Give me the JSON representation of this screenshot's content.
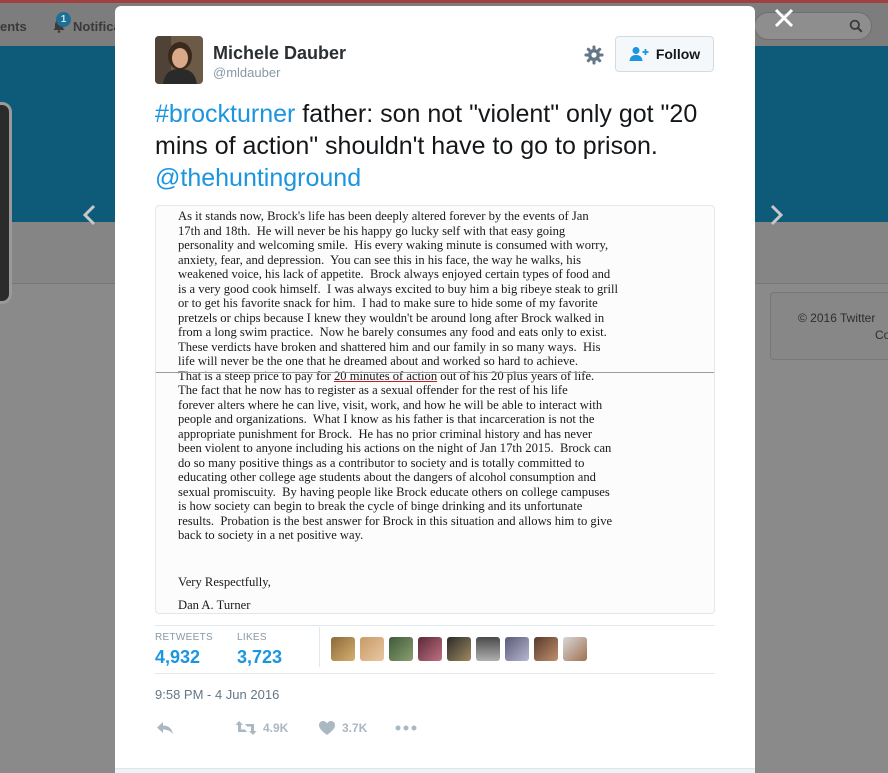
{
  "background": {
    "nav_left_fragment": "ents",
    "notifications_label": "Notifica",
    "notifications_count": "1",
    "copyright_line1": "© 2016 Twitter",
    "copyright_line2": "Co"
  },
  "tweet": {
    "author_name": "Michele Dauber",
    "author_handle": "@mldauber",
    "follow_label": "Follow",
    "text_hashtag": "#brockturner",
    "text_body": " father: son not \"violent\" only got \"20 mins of action\" shouldn't have to go to prison. ",
    "text_mention": "@thehuntinground",
    "retweets_label": "RETWEETS",
    "retweets_count": "4,932",
    "likes_label": "LIKES",
    "likes_count": "3,723",
    "timestamp": "9:58 PM - 4 Jun 2016",
    "retweet_action_count": "4.9K",
    "like_action_count": "3.7K"
  },
  "letter": {
    "lines_top": [
      "As it stands now, Brock's life has been deeply altered forever by the events of Jan",
      "17th and 18th.  He will never be his happy go lucky self with that easy going",
      "personality and welcoming smile.  His every waking minute is consumed with worry,",
      "anxiety, fear, and depression.  You can see this in his face, the way he walks, his",
      "weakened voice, his lack of appetite.  Brock always enjoyed certain types of food and",
      "is a very good cook himself.  I was always excited to buy him a big ribeye steak to grill",
      "or to get his favorite snack for him.  I had to make sure to hide some of my favorite",
      "pretzels or chips because I knew they wouldn't be around long after Brock walked in",
      "from a long swim practice.  Now he barely consumes any food and eats only to exist.",
      "These verdicts have broken and shattered him and our family in so many ways.  His",
      "life will never be the one that he dreamed about and worked so hard to achieve."
    ],
    "line_highlight_pre": "That is a steep price to pay for ",
    "line_highlight": "20 minutes of action",
    "line_highlight_post": " out of his 20 plus years of life.",
    "lines_bottom": [
      "The fact that he now has to register as a sexual offender for the rest of his life",
      "forever alters where he can live, visit, work, and how he will be able to interact with",
      "people and organizations.  What I know as his father is that incarceration is not the",
      "appropriate punishment for Brock.  He has no prior criminal history and has never",
      "been violent to anyone including his actions on the night of Jan 17th 2015.  Brock can",
      "do so many positive things as a contributor to society and is totally committed to",
      "educating other college age students about the dangers of alcohol consumption and",
      "sexual promiscuity.  By having people like Brock educate others on college campuses",
      "is how society can begin to break the cycle of binge drinking and its unfortunate",
      "results.  Probation is the best answer for Brock in this situation and allows him to give",
      "back to society in a net positive way."
    ],
    "closing": "Very Respectfully,",
    "signature": "Dan A. Turner"
  },
  "colors": {
    "link_blue": "#1b95e0",
    "banner_dimmed": "#0d5a79"
  },
  "icons": {
    "close": "close-icon",
    "prev": "chevron-left-icon",
    "next": "chevron-right-icon",
    "gear": "gear-icon",
    "follow": "follow-person-icon",
    "reply": "reply-icon",
    "retweet": "retweet-icon",
    "like": "heart-icon",
    "more": "more-dots-icon"
  }
}
